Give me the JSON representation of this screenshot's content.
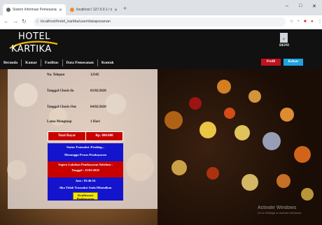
{
  "browser": {
    "tabs": [
      {
        "label": "Sistem Informasi Pemesanan Ka",
        "active": true
      },
      {
        "label": "localhost / 127.0.0.1 / sixhotel",
        "active": false
      }
    ],
    "new_tab": "+",
    "window_controls": {
      "minimize": "–",
      "maximize": "□",
      "close": "✕"
    },
    "url": "localhost/hotel_kartika/user/datapesanan"
  },
  "site": {
    "logo_top": "HOTEL",
    "logo_bottom": "KARTIKA",
    "menu": [
      "Beranda",
      "Kamar",
      "Fasilitas",
      "Data Pemesanan",
      "Kontak"
    ],
    "user_name": "DEPH",
    "profile_button": "Profil",
    "logout_button": "Keluar"
  },
  "booking": {
    "phone_label": "No. Telepon",
    "phone_value": "12345",
    "checkin_label": "Tanggal Check-In",
    "checkin_value": "03/02/2020",
    "checkout_label": "Tanggal Check-Out",
    "checkout_value": "04/02/2020",
    "duration_label": "Lama Menginap",
    "duration_value": "1 Hari",
    "total_label": "Total Bayar",
    "total_value": "Rp. 800.000",
    "status_line": "Status Transaksi :Pending...",
    "waiting_line": "Menunggu Proses Pembayaran",
    "deadline_line": "Segera Lakukan Pembayaran Sebelum :",
    "deadline_date": "Tanggal : 25/02/2020",
    "deadline_time": "Jam : 03:46:54",
    "cancel_line": "Jika Tidak Transaksi Anda Dibatalkan",
    "confirm_button_1": "Konfirmasi",
    "confirm_button_2": "Pembayaran"
  },
  "watermark": {
    "title": "Activate Windows",
    "subtitle": "Go to Settings to activate Windows."
  },
  "colors": {
    "header_bg": "#111111",
    "profile_red": "#c0121c",
    "logout_blue": "#1fa3df",
    "status_blue": "#1414cc",
    "alert_red": "#c80000",
    "confirm_yellow": "#f5e600"
  }
}
